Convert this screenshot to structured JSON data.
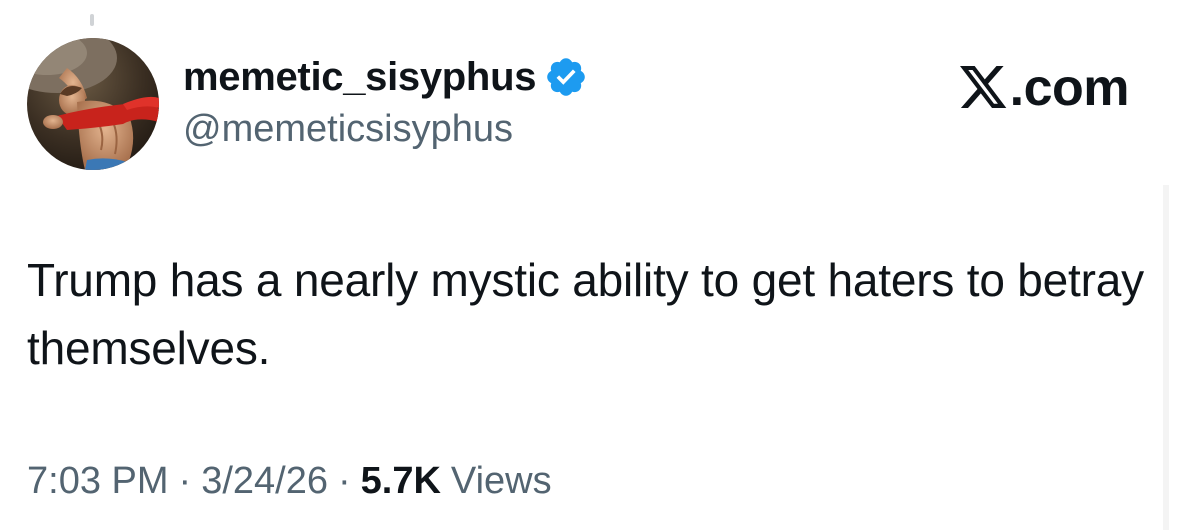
{
  "author": {
    "display_name": "memetic_sisyphus",
    "handle": "@memeticsisyphus",
    "verified": true,
    "verified_color": "#1d9bf0"
  },
  "brand": {
    "label": ".com",
    "icon": "x-logo-icon"
  },
  "tweet": {
    "text": "Trump has a nearly mystic ability to get haters to betray themselves."
  },
  "meta": {
    "time": "7:03 PM",
    "separator": "·",
    "date": "3/24/26",
    "views_count": "5.7K",
    "views_label": "Views"
  },
  "colors": {
    "text_primary": "#0f1419",
    "text_secondary": "#536471",
    "background": "#ffffff"
  }
}
